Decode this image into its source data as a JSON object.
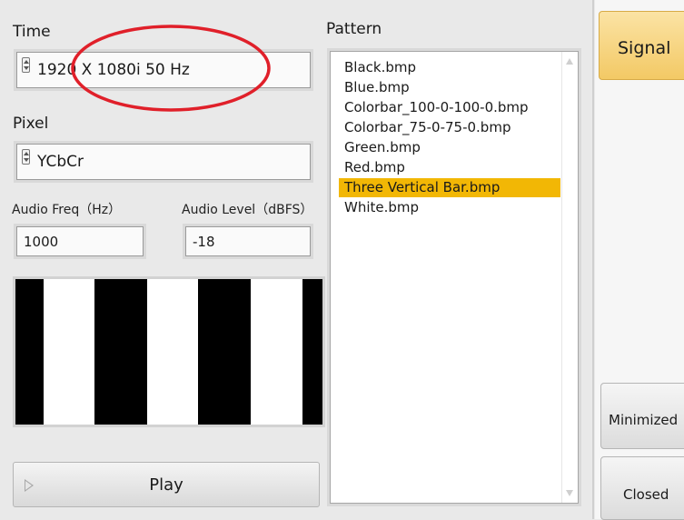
{
  "time": {
    "label": "Time",
    "value": "1920 X 1080i 50 Hz"
  },
  "pixel": {
    "label": "Pixel",
    "value": "YCbCr"
  },
  "audio": {
    "freq_label": "Audio Freq（Hz）",
    "freq_value": "1000",
    "level_label": "Audio Level（dBFS）",
    "level_value": "-18"
  },
  "preview": {
    "bars": [
      "#000000",
      "#ffffff",
      "#000000",
      "#ffffff",
      "#000000",
      "#ffffff",
      "#000000"
    ]
  },
  "play": {
    "label": "Play"
  },
  "pattern": {
    "label": "Pattern",
    "items": [
      "Black.bmp",
      "Blue.bmp",
      "Colorbar_100-0-100-0.bmp",
      "Colorbar_75-0-75-0.bmp",
      "Green.bmp",
      "Red.bmp",
      "Three Vertical Bar.bmp",
      "White.bmp"
    ],
    "selected_index": 6
  },
  "side": {
    "signal": "Signal",
    "minimized": "Minimized",
    "closed": "Closed"
  },
  "colors": {
    "accent": "#f2b705",
    "annotation": "#e0202a"
  }
}
